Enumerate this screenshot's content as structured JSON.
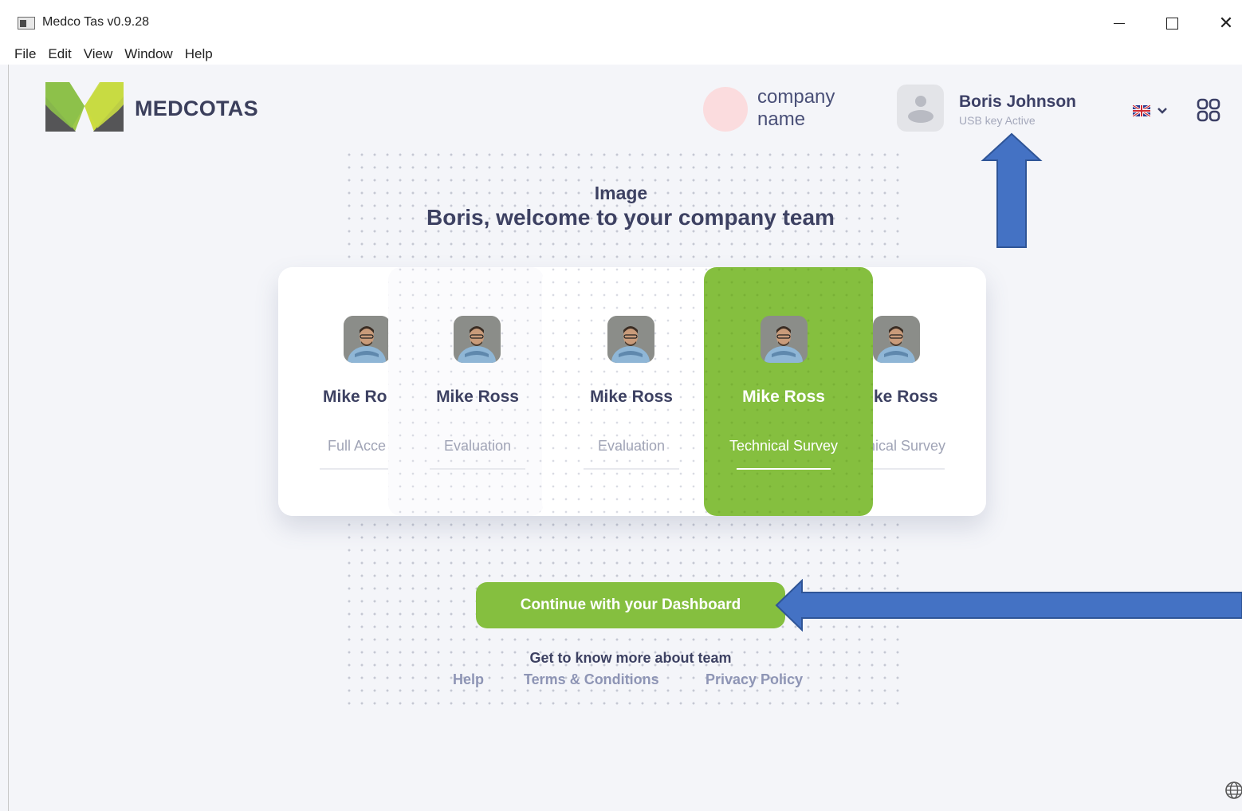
{
  "window": {
    "title": "Medco Tas v0.9.28",
    "minimize_icon": "minimize-icon",
    "maximize_icon": "maximize-icon",
    "close_glyph": "✕"
  },
  "menu": [
    "File",
    "Edit",
    "View",
    "Window",
    "Help"
  ],
  "header": {
    "brand": "MEDCOTAS",
    "company_name": "company name",
    "user_name": "Boris Johnson",
    "user_status": "USB key Active",
    "language_icon": "uk-flag-icon",
    "apps_icon": "grid-icon"
  },
  "main": {
    "image_label": "Image",
    "welcome": "Boris, welcome to your company team",
    "cards": [
      {
        "name": "Mike Ro",
        "role": "Full Acce"
      },
      {
        "name": "Mike Ross",
        "role": "Evaluation"
      },
      {
        "name": "Mike Ross",
        "role": "Evaluation"
      },
      {
        "name": "Mike Ross",
        "role": "Technical Survey",
        "selected": true
      },
      {
        "name": "ke Ross",
        "role": "nical Survey"
      }
    ],
    "cta": "Continue with your Dashboard",
    "more_info": "Get to know more about team",
    "links": {
      "help": "Help",
      "terms": "Terms & Conditions",
      "privacy": "Privacy Policy"
    }
  },
  "colors": {
    "accent_green": "#85bf3f",
    "annotation_arrow": "#4472c4",
    "text_dark": "#3d4162"
  }
}
